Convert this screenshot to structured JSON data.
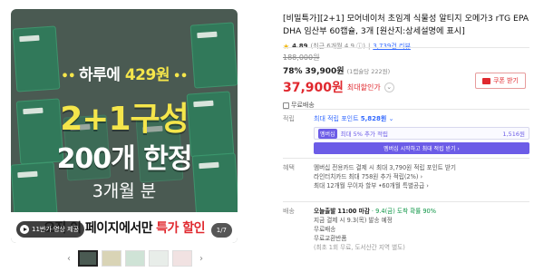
{
  "hero": {
    "line1_prefix": "하루에",
    "line1_price": "429원",
    "line2": "2+1구성",
    "line3": "200개 한정",
    "line4": "3개월 분",
    "bottom_text": "오직 이 페이지에서만",
    "bottom_highlight": "특가 할인",
    "badge_text": "11번가 영상 제공",
    "counter": "1/7"
  },
  "thumbs": {
    "prev": "‹",
    "next": "›"
  },
  "product": {
    "title": "[비밀특가][2+1] 모어네이처 초임계 식물성 알티지 오메가3 rTG EPA DHA 임산부 60캡슐, 3개 [원산지:상세설명에 표시]",
    "rating_score": "4.89",
    "rating_note": "(최근 6개월 4.9 ⓘ)",
    "review_count": "3,739건 리뷰"
  },
  "price": {
    "original": "188,000원",
    "discount_pct": "78%",
    "discount_price": "39,900원",
    "unit_price": "(1캡슐당 222원)",
    "sale_price": "37,900원",
    "sale_label": "최대할인가",
    "coupon_label": "쿠폰 받기",
    "free_shipping": "무료배송"
  },
  "points": {
    "label": "적립",
    "line": "최대 적립 포인트",
    "points_value": "5,828원",
    "promo_plus": "멤버십",
    "promo_text": "최대 5% 추가 적립",
    "promo_num": "1,516원",
    "join_text": "멤버십 시작하고 최대 적립 받기 ›"
  },
  "benefits": {
    "label": "혜택",
    "lines": [
      "멤버십 전용카드 결제 시 최대 3,790원 적립 포인트 받기",
      "라인터치카드 최대 758원 추가 적립(2%) ›",
      "최대 12개월 무이자 할부 •60개월 특별공급 ›"
    ]
  },
  "shipping": {
    "label": "배송",
    "today": "오늘출발",
    "today_time": "11:00 마감",
    "arrival": "· 9.4(금) 도착 확률 90%",
    "lines": [
      "지금 결제 시 9.3(목) 발송 예정",
      "무료배송",
      "무료교환반품",
      "(최초 1회 무료, 도서산간 지역 별도)"
    ]
  }
}
